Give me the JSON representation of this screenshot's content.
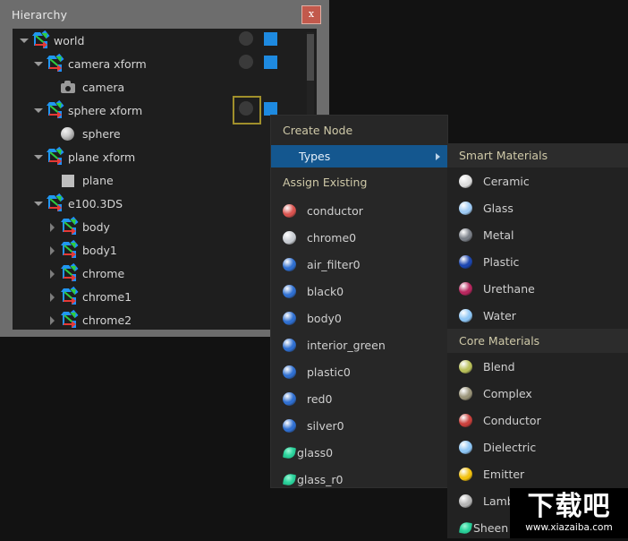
{
  "window": {
    "title": "Hierarchy",
    "close_label": "x"
  },
  "hierarchy": {
    "rows": [
      {
        "label": "world",
        "indent": 0,
        "twisty": "open",
        "icon": "xform-icon",
        "circle": true,
        "square": true,
        "selected": false
      },
      {
        "label": "camera xform",
        "indent": 1,
        "twisty": "open",
        "icon": "xform-icon",
        "circle": true,
        "square": true,
        "selected": false
      },
      {
        "label": "camera",
        "indent": 2,
        "twisty": "none",
        "icon": "camera-icon",
        "circle": false,
        "square": false,
        "selected": false
      },
      {
        "label": "sphere xform",
        "indent": 1,
        "twisty": "open",
        "icon": "xform-icon",
        "circle": true,
        "square": true,
        "selected": true
      },
      {
        "label": "sphere",
        "indent": 2,
        "twisty": "none",
        "icon": "sphere-icon",
        "circle": false,
        "square": false,
        "selected": false
      },
      {
        "label": "plane xform",
        "indent": 1,
        "twisty": "open",
        "icon": "xform-icon",
        "circle": false,
        "square": false,
        "selected": false
      },
      {
        "label": "plane",
        "indent": 2,
        "twisty": "none",
        "icon": "plane-icon",
        "circle": false,
        "square": false,
        "selected": false
      },
      {
        "label": "e100.3DS",
        "indent": 1,
        "twisty": "open",
        "icon": "xform-icon",
        "circle": false,
        "square": false,
        "selected": false
      },
      {
        "label": "body",
        "indent": 2,
        "twisty": "closed",
        "icon": "xform-icon",
        "circle": false,
        "square": false,
        "selected": false
      },
      {
        "label": "body1",
        "indent": 2,
        "twisty": "closed",
        "icon": "xform-icon",
        "circle": false,
        "square": false,
        "selected": false
      },
      {
        "label": "chrome",
        "indent": 2,
        "twisty": "closed",
        "icon": "xform-icon",
        "circle": false,
        "square": false,
        "selected": false
      },
      {
        "label": "chrome1",
        "indent": 2,
        "twisty": "closed",
        "icon": "xform-icon",
        "circle": false,
        "square": false,
        "selected": false
      },
      {
        "label": "chrome2",
        "indent": 2,
        "twisty": "closed",
        "icon": "xform-icon",
        "circle": false,
        "square": false,
        "selected": false
      }
    ]
  },
  "context_menu": {
    "create_header": "Create Node",
    "types_label": "Types",
    "assign_header": "Assign Existing",
    "items": [
      {
        "label": "conductor",
        "color": "#d9534f"
      },
      {
        "label": "chrome0",
        "color": "#c8ccd2"
      },
      {
        "label": "air_filter0",
        "color": "#2f6fd0"
      },
      {
        "label": "black0",
        "color": "#2f6fd0"
      },
      {
        "label": "body0",
        "color": "#2f6fd0"
      },
      {
        "label": "interior_green",
        "color": "#2f6fd0"
      },
      {
        "label": "plastic0",
        "color": "#2f6fd0"
      },
      {
        "label": "red0",
        "color": "#2f6fd0"
      },
      {
        "label": "silver0",
        "color": "#2f6fd0"
      },
      {
        "label": "glass0",
        "color": "#2fd69f",
        "shape": "leaf"
      },
      {
        "label": "glass_r0",
        "color": "#2fd69f",
        "shape": "leaf"
      }
    ]
  },
  "materials_panel": {
    "sections": [
      {
        "header": "Smart Materials",
        "items": [
          {
            "label": "Ceramic",
            "color": "#dcdcdc"
          },
          {
            "label": "Glass",
            "color": "#9ecbf5"
          },
          {
            "label": "Metal",
            "color": "#7b8088"
          },
          {
            "label": "Plastic",
            "color": "#1c46b0"
          },
          {
            "label": "Urethane",
            "color": "#b8275f"
          },
          {
            "label": "Water",
            "color": "#8ec6f5"
          }
        ]
      },
      {
        "header": "Core Materials",
        "items": [
          {
            "label": "Blend",
            "color": "#b9c05a"
          },
          {
            "label": "Complex",
            "color": "#9a9479"
          },
          {
            "label": "Conductor",
            "color": "#c9403c"
          },
          {
            "label": "Dielectric",
            "color": "#8ec6f5"
          },
          {
            "label": "Emitter",
            "color": "#f2c10f"
          },
          {
            "label": "Lambertian",
            "color": "#b5b5b5"
          },
          {
            "label": "Sheen",
            "color": "#2fd69f",
            "shape": "leaf"
          }
        ]
      }
    ]
  },
  "watermark": {
    "cn": "下载吧",
    "url": "www.xiazaiba.com"
  }
}
